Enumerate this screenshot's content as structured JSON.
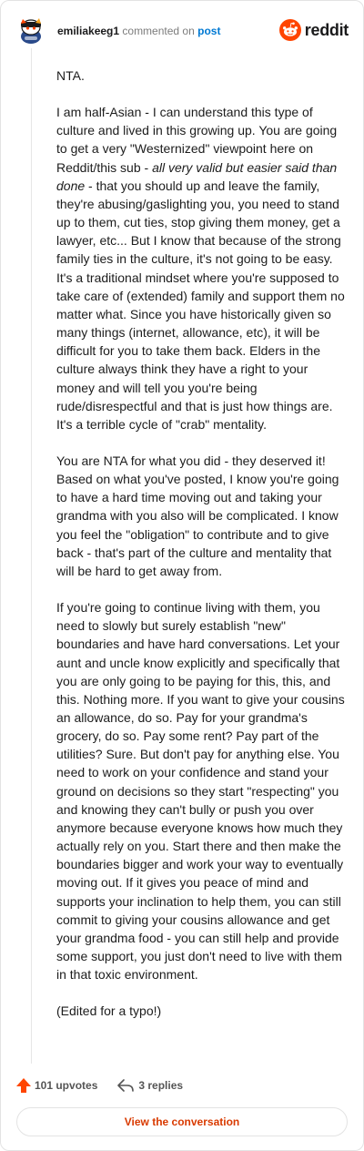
{
  "header": {
    "username": "emiliakeeg1",
    "commented_on": "commented on",
    "post_link": "post",
    "brand": "reddit"
  },
  "comment": {
    "paragraphs": [
      "NTA.",
      "I am half-Asian - I can understand this type of culture and lived in this growing up. You are going to get a very \"Westernized\" viewpoint here on Reddit/this sub - ",
      "You are NTA for what you did - they deserved it! Based on what you've posted, I know you're going to have a hard time moving out and taking your grandma with you also will be complicated. I know you feel the \"obligation\" to contribute and to give back - that's part of the culture and mentality that will be hard to get away from.",
      "If you're going to continue living with them, you need to slowly but surely establish \"new\" boundaries and have hard conversations. Let your aunt and uncle know explicitly and specifically that you are only going to be paying for this, this, and this. Nothing more. If you want to give your cousins an allowance, do so. Pay for your grandma's grocery, do so. Pay some rent? Pay part of the utilities? Sure. But don't pay for anything else. You need to work on your confidence and stand your ground on decisions so they start \"respecting\" you and knowing they can't bully or push you over anymore because everyone knows how much they actually rely on you. Start there and then make the boundaries bigger and work your way to eventually moving out. If it gives you peace of mind and supports your inclination to help them, you can still commit to giving your cousins allowance and get your grandma food - you can still help and provide some support, you just don't need to live with them in that toxic environment.",
      "(Edited for a typo!)"
    ],
    "italic": "all very valid but easier said than done",
    "after_italic": " - that you should up and leave the family, they're abusing/gaslighting you, you need to stand up to them, cut ties, stop giving them money, get a lawyer, etc... But I know that because of the strong family ties in the culture, it's not going to be easy. It's a traditional mindset where you're supposed to take care of (extended) family and support them no matter what. Since you have historically given so many things (internet, allowance, etc), it will be difficult for you to take them back. Elders in the culture always think they have a right to your money and will tell you you're being rude/disrespectful and that is just how things are. It's a terrible cycle of \"crab\" mentality."
  },
  "footer": {
    "upvotes": "101 upvotes",
    "replies": "3 replies",
    "view_button": "View the conversation"
  },
  "icons": {
    "avatar": "snoo-avatar-icon",
    "brand": "reddit-logo-icon",
    "upvote": "upvote-arrow-icon",
    "reply": "reply-arrow-icon"
  },
  "colors": {
    "accent": "#ff4500",
    "link": "#0079d3",
    "button_text": "#d93a00"
  }
}
